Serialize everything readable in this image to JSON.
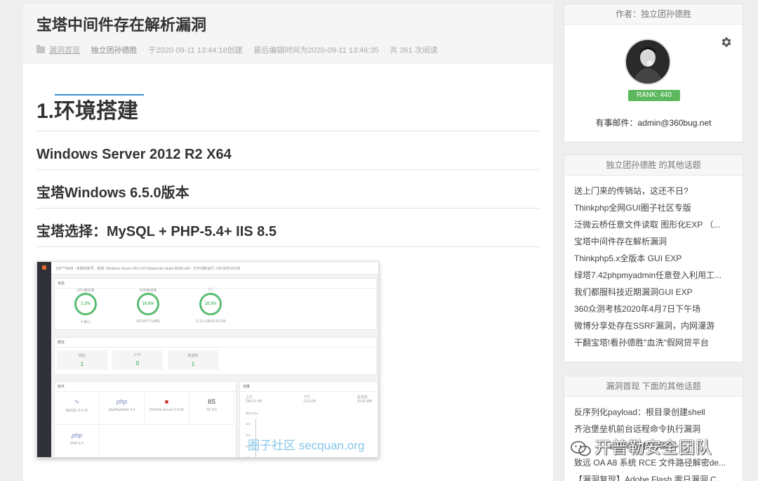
{
  "article": {
    "title": "宝塔中间件存在解析漏洞",
    "category": "漏洞首现",
    "author": "独立团孙德胜",
    "created": "于2020-09-11 13:44:18创建",
    "edited": "最后编辑时间为2020-09-11 13:46:35",
    "reads": "共 361 次阅读",
    "h1": "1.环境搭建",
    "h3_list": [
      "Windows Server 2012 R2 X64",
      "宝塔Windows 6.5.0版本",
      "宝塔选择：MySQL + PHP-5.4+ IIS 8.5"
    ]
  },
  "screenshot": {
    "topbar": "136***8828  ·  未绑定账号  ·  系统: Windows Server 2012 R2 Datacenter (build 9600) x64  ·  已不间断运行: 0天16时18分钟",
    "status_title": "状态",
    "gauges": [
      {
        "label": "CPU使用率",
        "value": "2.2%",
        "sub": "4 核心"
      },
      {
        "label": "内存使用率",
        "value": "16.6%",
        "sub": "1470/8771(MB)"
      },
      {
        "label": "C:/",
        "value": "18.3%",
        "sub": "11.01 GB/60.00 GB"
      }
    ],
    "overview_title": "概览",
    "stats": [
      {
        "label": "网站",
        "value": "1"
      },
      {
        "label": "FTP",
        "value": "0"
      },
      {
        "label": "数据库",
        "value": "1"
      }
    ],
    "software_title": "软件",
    "software": [
      "MySQL 5.5.41",
      "phpMyAdmin 4.0",
      "FileZilla Server 0.9.60",
      "IIS 8.5",
      "PHP-5.4"
    ],
    "traffic_title": "流量",
    "traffic": [
      {
        "label": "上行",
        "value": "249.57 KB"
      },
      {
        "label": "下行",
        "value": "13.0 KB"
      },
      {
        "label": "总发送",
        "value": "20.00 MB"
      }
    ],
    "traffic_unit": "单位:KB/s",
    "y_ticks": [
      "500",
      "400",
      "300",
      "200"
    ],
    "watermark": "圈子社区 secquan.org"
  },
  "sidebar": {
    "author_header": "作者：独立团孙德胜",
    "rank": "RANK: 440",
    "email": "有事邮件：admin@360bug.net",
    "other_header": "独立团孙德胜 的其他话题",
    "other_topics": [
      "送上门来的传销站，这还不日?",
      "Thinkphp全网GUI圈子社区专版",
      "泛微云桥任意文件读取 图形化EXP （...",
      "宝塔中间件存在解析漏洞",
      "Thinkphp5.x全版本 GUI EXP",
      "绿塔7.42phpmyadmin任意登入利用工...",
      "我们都服科技近期漏洞GUI EXP",
      "360众测考核2020年4月7日下午场",
      "微博分享处存在SSRF漏洞，内网漫游",
      "干翻宝塔!看孙德胜\"血洗\"假网贷平台"
    ],
    "cat_header": "漏洞首现 下面的其他话题",
    "cat_topics": [
      "反序列化payload：根目录创建shell",
      "齐治堡垒机前台远程命令执行漏洞",
      "远程命令执行漏洞",
      "致远 OA A8 系统 RCE 文件路径解密de...",
      "【漏洞复现】Adobe Flash 零日漏洞 C..."
    ]
  },
  "overlay": {
    "wechat_label": "开普勒安全团队"
  },
  "colors": {
    "accent_blue": "#3c8dd0",
    "rank_green": "#5cb85c",
    "bt_green": "#20a53a"
  }
}
